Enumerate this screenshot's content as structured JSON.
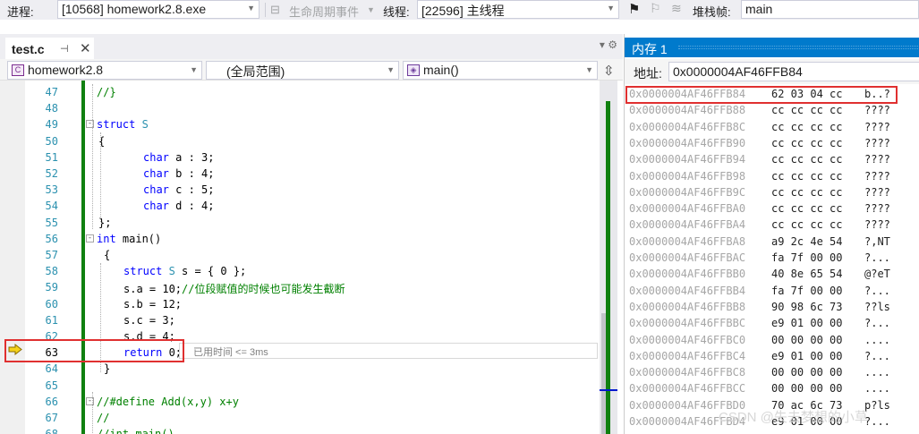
{
  "toolbar": {
    "process_label": "进程:",
    "process_value": "[10568] homework2.8.exe",
    "lifecycle_label": "生命周期事件",
    "thread_label": "线程:",
    "thread_value": "[22596] 主线程",
    "stackframe_label": "堆栈帧:",
    "stackframe_value": "main"
  },
  "editor_tab": {
    "name": "test.c"
  },
  "navbar": {
    "project": "homework2.8",
    "scope": "(全局范围)",
    "function": "main()"
  },
  "code_lines": [
    {
      "num": "47",
      "html_parts": [
        {
          "t": "//}",
          "c": "cm"
        }
      ]
    },
    {
      "num": "48",
      "html_parts": []
    },
    {
      "num": "49",
      "html_parts": [
        {
          "t": "struct ",
          "c": "kw"
        },
        {
          "t": "S",
          "c": "ty"
        }
      ]
    },
    {
      "num": "50",
      "html_parts": [
        {
          "t": "{",
          "c": ""
        }
      ]
    },
    {
      "num": "51",
      "html_parts": [
        {
          "t": "char",
          "c": "kw"
        },
        {
          "t": " a : 3;",
          "c": ""
        }
      ]
    },
    {
      "num": "52",
      "html_parts": [
        {
          "t": "char",
          "c": "kw"
        },
        {
          "t": " b : 4;",
          "c": ""
        }
      ]
    },
    {
      "num": "53",
      "html_parts": [
        {
          "t": "char",
          "c": "kw"
        },
        {
          "t": " c : 5;",
          "c": ""
        }
      ]
    },
    {
      "num": "54",
      "html_parts": [
        {
          "t": "char",
          "c": "kw"
        },
        {
          "t": " d : 4;",
          "c": ""
        }
      ]
    },
    {
      "num": "55",
      "html_parts": [
        {
          "t": "};",
          "c": ""
        }
      ]
    },
    {
      "num": "56",
      "html_parts": [
        {
          "t": "int",
          "c": "kw"
        },
        {
          "t": " main()",
          "c": ""
        }
      ]
    },
    {
      "num": "57",
      "html_parts": [
        {
          "t": "{",
          "c": ""
        }
      ]
    },
    {
      "num": "58",
      "html_parts": [
        {
          "t": "struct ",
          "c": "kw"
        },
        {
          "t": "S",
          "c": "ty"
        },
        {
          "t": " s = { 0 };",
          "c": ""
        }
      ]
    },
    {
      "num": "59",
      "html_parts": [
        {
          "t": "s.a = 10;",
          "c": ""
        },
        {
          "t": "//位段赋值的时候也可能发生截断",
          "c": "cm"
        }
      ]
    },
    {
      "num": "60",
      "html_parts": [
        {
          "t": "s.b = 12;",
          "c": ""
        }
      ]
    },
    {
      "num": "61",
      "html_parts": [
        {
          "t": "s.c = 3;",
          "c": ""
        }
      ]
    },
    {
      "num": "62",
      "html_parts": [
        {
          "t": "s.d = 4;",
          "c": ""
        }
      ]
    },
    {
      "num": "63",
      "html_parts": [
        {
          "t": "return",
          "c": "kw"
        },
        {
          "t": " 0;",
          "c": ""
        }
      ]
    },
    {
      "num": "64",
      "html_parts": [
        {
          "t": "}",
          "c": ""
        }
      ]
    },
    {
      "num": "65",
      "html_parts": []
    },
    {
      "num": "66",
      "html_parts": [
        {
          "t": "//#define Add(x,y) x+y",
          "c": "cm"
        }
      ]
    },
    {
      "num": "67",
      "html_parts": [
        {
          "t": "//",
          "c": "cm"
        }
      ]
    },
    {
      "num": "68",
      "html_parts": [
        {
          "t": "//int main()",
          "c": "cm"
        }
      ]
    }
  ],
  "elapsed_hint": "已用时间 <= 3ms",
  "memory": {
    "title": "内存 1",
    "address_label": "地址:",
    "address_value": "0x0000004AF46FFB84",
    "rows": [
      {
        "addr": "0x0000004AF46FFB84",
        "bytes": "62 03 04 cc",
        "chars": "b..?"
      },
      {
        "addr": "0x0000004AF46FFB88",
        "bytes": "cc cc cc cc",
        "chars": "????"
      },
      {
        "addr": "0x0000004AF46FFB8C",
        "bytes": "cc cc cc cc",
        "chars": "????"
      },
      {
        "addr": "0x0000004AF46FFB90",
        "bytes": "cc cc cc cc",
        "chars": "????"
      },
      {
        "addr": "0x0000004AF46FFB94",
        "bytes": "cc cc cc cc",
        "chars": "????"
      },
      {
        "addr": "0x0000004AF46FFB98",
        "bytes": "cc cc cc cc",
        "chars": "????"
      },
      {
        "addr": "0x0000004AF46FFB9C",
        "bytes": "cc cc cc cc",
        "chars": "????"
      },
      {
        "addr": "0x0000004AF46FFBA0",
        "bytes": "cc cc cc cc",
        "chars": "????"
      },
      {
        "addr": "0x0000004AF46FFBA4",
        "bytes": "cc cc cc cc",
        "chars": "????"
      },
      {
        "addr": "0x0000004AF46FFBA8",
        "bytes": "a9 2c 4e 54",
        "chars": "?,NT"
      },
      {
        "addr": "0x0000004AF46FFBAC",
        "bytes": "fa 7f 00 00",
        "chars": "?..."
      },
      {
        "addr": "0x0000004AF46FFBB0",
        "bytes": "40 8e 65 54",
        "chars": "@?eT"
      },
      {
        "addr": "0x0000004AF46FFBB4",
        "bytes": "fa 7f 00 00",
        "chars": "?..."
      },
      {
        "addr": "0x0000004AF46FFBB8",
        "bytes": "90 98 6c 73",
        "chars": "??ls"
      },
      {
        "addr": "0x0000004AF46FFBBC",
        "bytes": "e9 01 00 00",
        "chars": "?..."
      },
      {
        "addr": "0x0000004AF46FFBC0",
        "bytes": "00 00 00 00",
        "chars": "...."
      },
      {
        "addr": "0x0000004AF46FFBC4",
        "bytes": "e9 01 00 00",
        "chars": "?..."
      },
      {
        "addr": "0x0000004AF46FFBC8",
        "bytes": "00 00 00 00",
        "chars": "...."
      },
      {
        "addr": "0x0000004AF46FFBCC",
        "bytes": "00 00 00 00",
        "chars": "...."
      },
      {
        "addr": "0x0000004AF46FFBD0",
        "bytes": "70 ac 6c 73",
        "chars": "p?ls"
      },
      {
        "addr": "0x0000004AF46FFBD4",
        "bytes": "e9 01 00 00",
        "chars": "?..."
      }
    ]
  },
  "watermark": "CSDN @失去梦想的小草",
  "colors": {
    "accent": "#007acc",
    "highlight_box": "#e03030",
    "change_bar": "#108010"
  }
}
